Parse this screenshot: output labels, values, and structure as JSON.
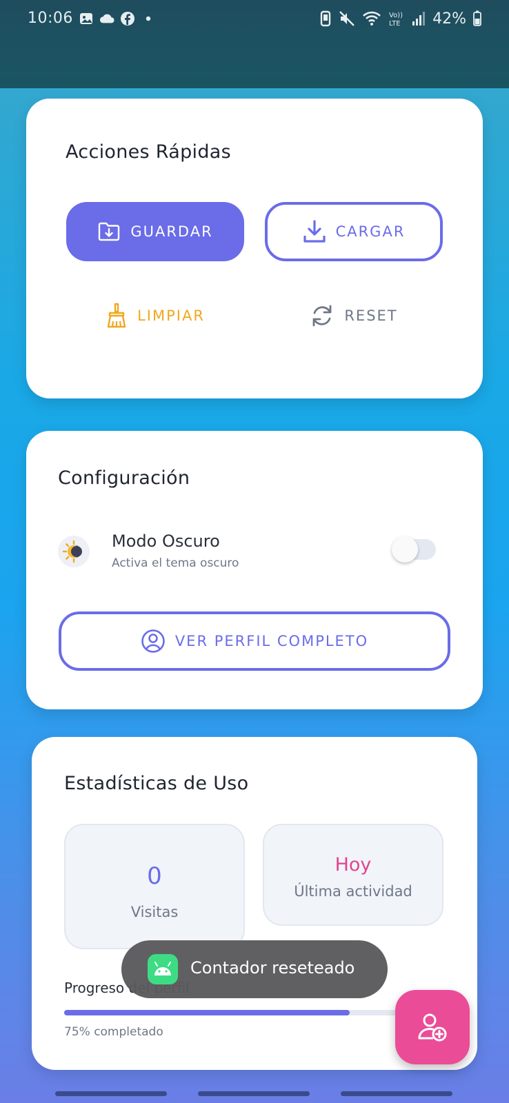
{
  "status_bar": {
    "time": "10:06",
    "battery": "42%",
    "left_icons": [
      "gallery-icon",
      "cloud-icon",
      "facebook-icon",
      "dot-icon"
    ],
    "right_icons": [
      "vibrate-icon",
      "mute-icon",
      "wifi-icon",
      "volte-icon",
      "signal-icon",
      "battery-icon"
    ]
  },
  "quick_actions": {
    "title": "Acciones Rápidas",
    "save_label": "GUARDAR",
    "load_label": "CARGAR",
    "clear_label": "LIMPIAR",
    "reset_label": "RESET"
  },
  "settings": {
    "title": "Configuración",
    "dark_mode_title": "Modo Oscuro",
    "dark_mode_subtitle": "Activa el tema oscuro",
    "dark_mode_enabled": false,
    "profile_button": "VER PERFIL COMPLETO"
  },
  "stats": {
    "title": "Estadísticas de Uso",
    "visits_value": "0",
    "visits_label": "Visitas",
    "last_activity_value": "Hoy",
    "last_activity_label": "Última actividad",
    "progress_label": "Progreso del perfil",
    "progress_percent": 75,
    "progress_text": "75% completado"
  },
  "toast": {
    "message": "Contador reseteado"
  },
  "colors": {
    "accent": "#6a6ce8",
    "amber": "#f0a81e",
    "pink": "#ea4c97",
    "muted": "#6f7787"
  }
}
